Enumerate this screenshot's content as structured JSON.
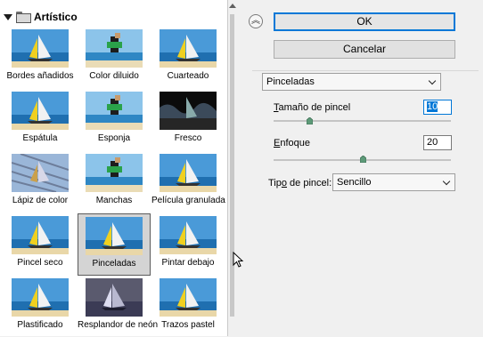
{
  "gallery": {
    "category": "Artístico",
    "filters": [
      {
        "label": "Bordes añadidos",
        "scene": "sailboat",
        "selected": false
      },
      {
        "label": "Color diluido",
        "scene": "figure",
        "selected": false
      },
      {
        "label": "Cuarteado",
        "scene": "sailboat",
        "selected": false
      },
      {
        "label": "Espátula",
        "scene": "sailboat",
        "selected": false
      },
      {
        "label": "Esponja",
        "scene": "figure",
        "selected": false
      },
      {
        "label": "Fresco",
        "scene": "dark",
        "selected": false
      },
      {
        "label": "Lápiz de color",
        "scene": "sketch",
        "selected": false
      },
      {
        "label": "Manchas",
        "scene": "figure",
        "selected": false
      },
      {
        "label": "Película granulada",
        "scene": "sailboat",
        "selected": false
      },
      {
        "label": "Pincel seco",
        "scene": "sailboat",
        "selected": false
      },
      {
        "label": "Pinceladas",
        "scene": "sailboat",
        "selected": true
      },
      {
        "label": "Pintar debajo",
        "scene": "sailboat",
        "selected": false
      },
      {
        "label": "Plastificado",
        "scene": "sailboat",
        "selected": false
      },
      {
        "label": "Resplandor de neón",
        "scene": "neon",
        "selected": false
      },
      {
        "label": "Trazos pastel",
        "scene": "sailboat",
        "selected": false
      }
    ]
  },
  "buttons": {
    "ok": "OK",
    "cancel": "Cancelar"
  },
  "settings": {
    "filter_select": "Pinceladas",
    "brush_size": {
      "label_underlined": "T",
      "label_rest": "amaño de pincel",
      "value": "10",
      "slider_fraction": 0.2
    },
    "sharpness": {
      "label_underlined": "E",
      "label_rest": "nfoque",
      "value": "20",
      "slider_fraction": 0.5
    },
    "brush_type": {
      "label_before": "Tip",
      "label_underlined": "o",
      "label_after": " de pincel:",
      "value": "Sencillo"
    }
  },
  "colors": {
    "accent": "#0078d7",
    "selected_thumb_bg": "#d4d4d4",
    "knob": "#5d9a78"
  }
}
